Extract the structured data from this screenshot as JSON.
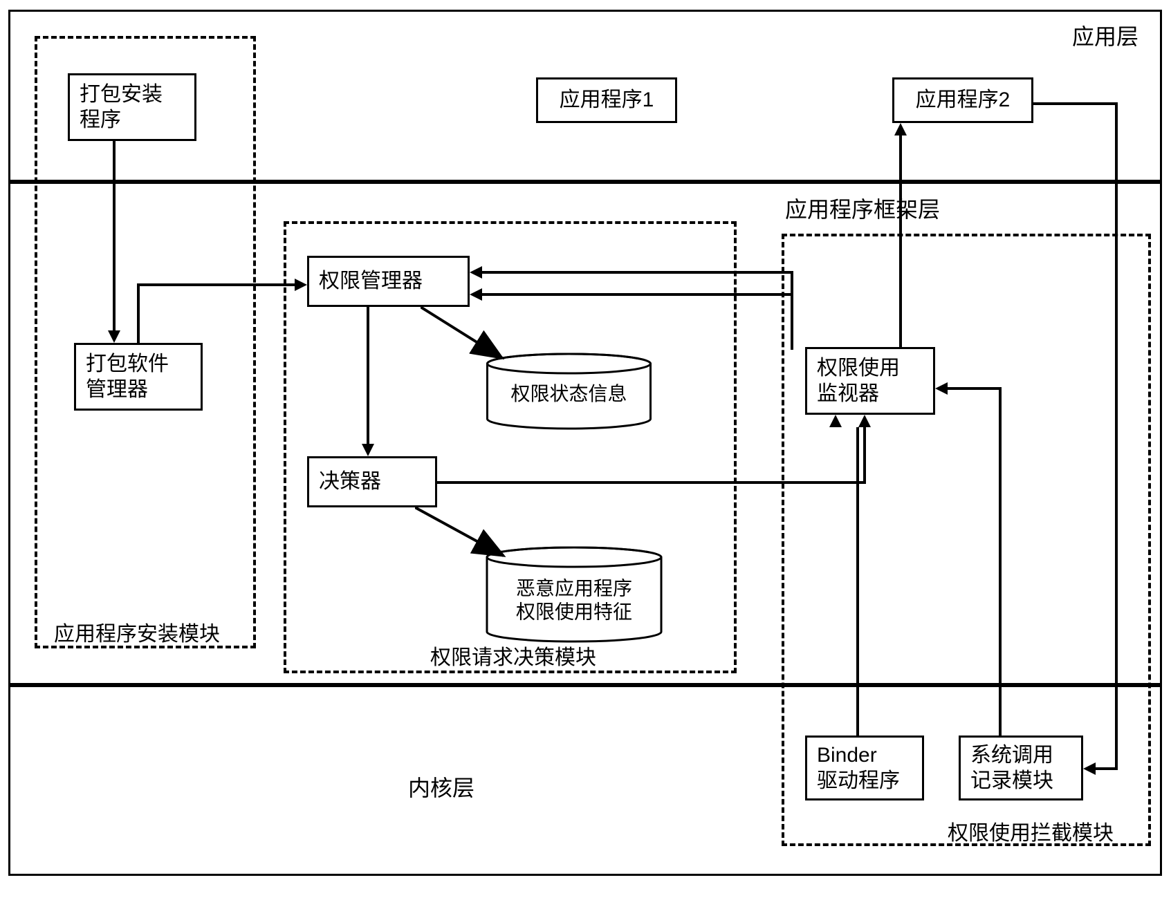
{
  "layers": {
    "application": "应用层",
    "framework": "应用程序框架层",
    "kernel": "内核层"
  },
  "modules": {
    "install": "应用程序安装模块",
    "decision": "权限请求决策模块",
    "intercept": "权限使用拦截模块"
  },
  "boxes": {
    "package_installer": "打包安装\n程序",
    "app1": "应用程序1",
    "app2": "应用程序2",
    "package_manager": "打包软件\n管理器",
    "perm_manager": "权限管理器",
    "decider": "决策器",
    "perm_monitor": "权限使用\n监视器",
    "binder_driver": "Binder\n驱动程序",
    "syscall_recorder": "系统调用\n记录模块"
  },
  "dbs": {
    "perm_status": "权限状态信息",
    "malicious_features": "恶意应用程序\n权限使用特征"
  },
  "chart_data": {
    "type": "diagram",
    "title": "",
    "layers": [
      {
        "name": "应用层",
        "contains": [
          "打包安装程序",
          "应用程序1",
          "应用程序2"
        ]
      },
      {
        "name": "应用程序框架层",
        "contains": [
          "打包软件管理器",
          "权限管理器",
          "决策器",
          "权限状态信息",
          "恶意应用程序权限使用特征",
          "权限使用监视器"
        ]
      },
      {
        "name": "内核层",
        "contains": [
          "Binder驱动程序",
          "系统调用记录模块"
        ]
      }
    ],
    "modules": [
      {
        "name": "应用程序安装模块",
        "contains": [
          "打包安装程序",
          "打包软件管理器"
        ]
      },
      {
        "name": "权限请求决策模块",
        "contains": [
          "权限管理器",
          "决策器",
          "权限状态信息",
          "恶意应用程序权限使用特征"
        ]
      },
      {
        "name": "权限使用拦截模块",
        "contains": [
          "权限使用监视器",
          "Binder驱动程序",
          "系统调用记录模块",
          "应用程序2"
        ]
      }
    ],
    "edges": [
      {
        "from": "打包安装程序",
        "to": "打包软件管理器",
        "directed": true
      },
      {
        "from": "打包软件管理器",
        "to": "权限管理器",
        "directed": true
      },
      {
        "from": "权限管理器",
        "to": "权限状态信息",
        "directed": true
      },
      {
        "from": "权限管理器",
        "to": "决策器",
        "directed": true
      },
      {
        "from": "决策器",
        "to": "恶意应用程序权限使用特征",
        "directed": true
      },
      {
        "from": "决策器",
        "to": "权限使用监视器",
        "directed": true
      },
      {
        "from": "权限使用监视器",
        "to": "权限管理器",
        "directed": true
      },
      {
        "from": "权限使用监视器",
        "to": "应用程序2",
        "directed": true
      },
      {
        "from": "Binder驱动程序",
        "to": "权限使用监视器",
        "directed": true
      },
      {
        "from": "系统调用记录模块",
        "to": "权限使用监视器",
        "directed": true
      },
      {
        "from": "应用程序2",
        "to": "系统调用记录模块",
        "directed": true
      },
      {
        "from": "应用程序2",
        "to": "权限管理器",
        "directed": true,
        "note": "through 权限使用拦截模块 boundary"
      }
    ]
  }
}
